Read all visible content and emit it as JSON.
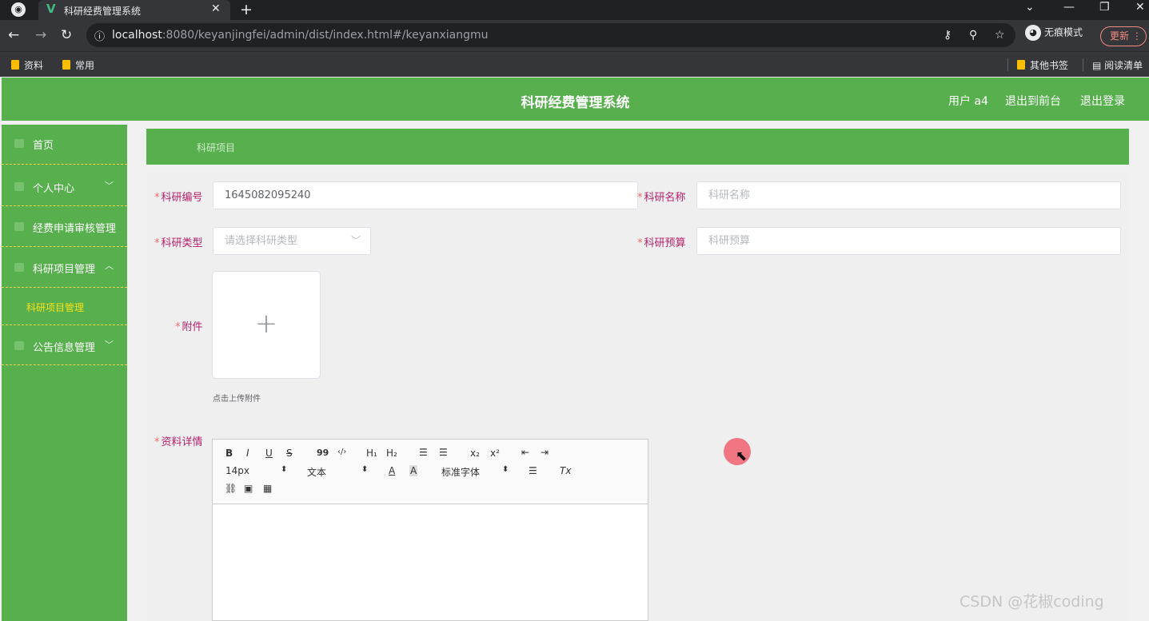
{
  "browser": {
    "tab_title": "科研经费管理系统",
    "url_host": "localhost",
    "url_rest": ":8080/keyanjingfei/admin/dist/index.html#/keyanxiangmu",
    "incognito_label": "无痕模式",
    "update_label": "更新",
    "bookmarks": [
      "资料",
      "常用"
    ],
    "bookmarks_right": [
      "其他书签",
      "阅读清单"
    ]
  },
  "header": {
    "title": "科研经费管理系统",
    "user": "用户 a4",
    "back_to_front": "退出到前台",
    "logout": "退出登录"
  },
  "sidebar": {
    "items": [
      {
        "label": "首页"
      },
      {
        "label": "个人中心"
      },
      {
        "label": "经费申请审核管理"
      },
      {
        "label": "科研项目管理"
      },
      {
        "label": "科研项目管理"
      },
      {
        "label": "公告信息管理"
      }
    ]
  },
  "breadcrumb": {
    "current": "科研项目"
  },
  "form": {
    "code_label": "科研编号",
    "code_value": "1645082095240",
    "name_label": "科研名称",
    "name_placeholder": "科研名称",
    "type_label": "科研类型",
    "type_placeholder": "请选择科研类型",
    "budget_label": "科研预算",
    "budget_placeholder": "科研预算",
    "attachment_label": "附件",
    "upload_tip": "点击上传附件",
    "details_label": "资料详情"
  },
  "editor": {
    "font_size": "14px",
    "header_select": "文本",
    "font_family": "标准字体",
    "buttons": [
      "B",
      "I",
      "U",
      "S",
      "99",
      "‹/›",
      "H₁",
      "H₂",
      "x₂",
      "x²",
      "Tx"
    ]
  },
  "watermark": "CSDN @花椒coding"
}
